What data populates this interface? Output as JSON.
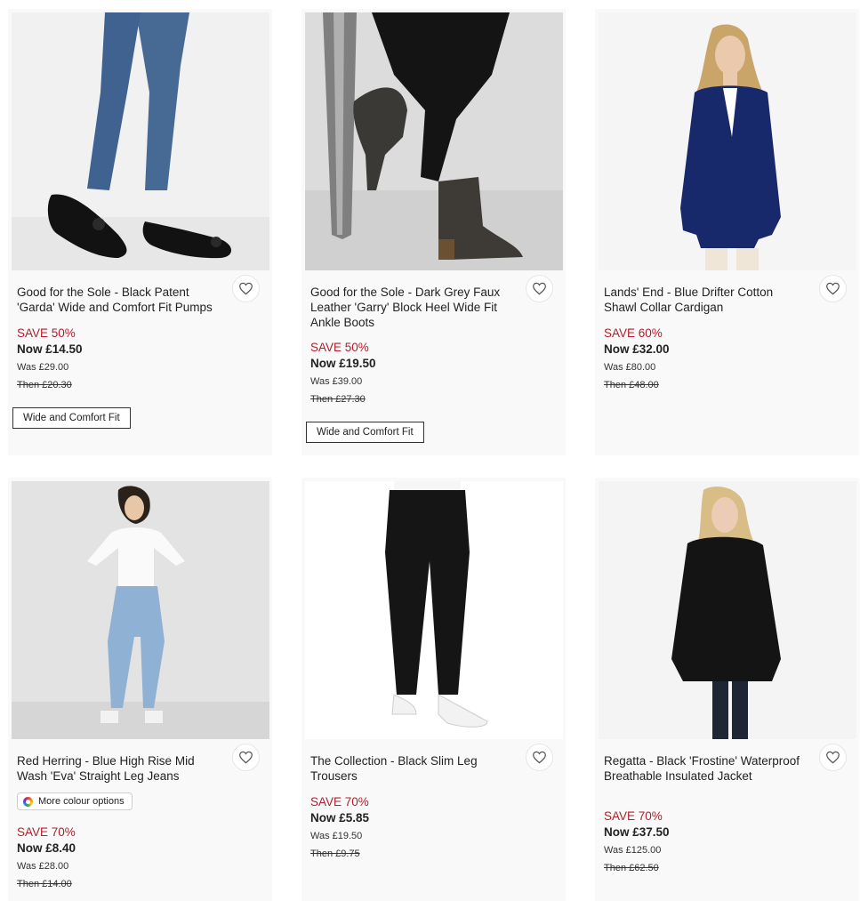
{
  "products": [
    {
      "title": "Good for the Sole - Black Patent 'Garda' Wide and Comfort Fit Pumps",
      "image": "pumps-image",
      "save": "SAVE 50%",
      "now": "Now £14.50",
      "was": "Was £29.00",
      "then": "Then £20.30",
      "tag": "Wide and Comfort Fit"
    },
    {
      "title": "Good for the Sole - Dark Grey Faux Leather 'Garry' Block Heel Wide Fit Ankle Boots",
      "image": "ankle-boots-image",
      "save": "SAVE 50%",
      "now": "Now £19.50",
      "was": "Was £39.00",
      "then": "Then £27.30",
      "tag": "Wide and Comfort Fit"
    },
    {
      "title": "Lands' End - Blue Drifter Cotton Shawl Collar Cardigan",
      "image": "cardigan-image",
      "save": "SAVE 60%",
      "now": "Now £32.00",
      "was": "Was £80.00",
      "then": "Then £48.00"
    },
    {
      "title": "Red Herring - Blue High Rise Mid Wash 'Eva' Straight Leg Jeans",
      "image": "jeans-image",
      "colour_options": "More colour options",
      "save": "SAVE 70%",
      "now": "Now £8.40",
      "was": "Was £28.00",
      "then": "Then £14.00"
    },
    {
      "title": "The Collection - Black Slim Leg Trousers",
      "image": "trousers-image",
      "save": "SAVE 70%",
      "now": "Now £5.85",
      "was": "Was £19.50",
      "then": "Then £9.75"
    },
    {
      "title": "Regatta - Black 'Frostine' Waterproof Breathable Insulated Jacket",
      "image": "jacket-image",
      "save": "SAVE 70%",
      "now": "Now £37.50",
      "was": "Was £125.00",
      "then": "Then £62.50"
    }
  ],
  "icons": {
    "wishlist": "heart-outline-icon",
    "colours": "colour-wheel-icon"
  },
  "colors": {
    "sale_red": "#b41d2b",
    "card_bg": "#f9f9f9",
    "text": "#222222"
  }
}
